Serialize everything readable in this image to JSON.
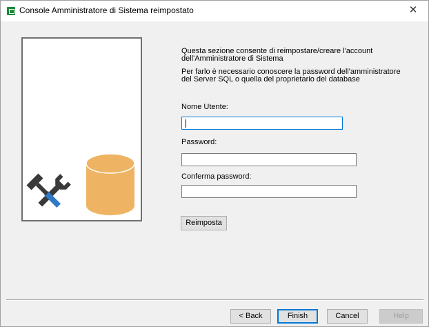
{
  "window": {
    "title": "Console Amministratore di Sistema reimpostato",
    "close_glyph": "✕"
  },
  "icons": {
    "app": "database-app-icon",
    "tools": "tools-icon",
    "database": "database-icon"
  },
  "colors": {
    "database": "#efb463",
    "tools": "#3a3a3a",
    "screwdriver": "#2f79c6",
    "focus": "#0078d7"
  },
  "intro": {
    "line1": "Questa sezione consente di reimpostare/creare l'account dell'Amministratore di Sistema",
    "line2": "Per farlo è necessario conoscere la password dell'amministratore del Server SQL o quella del proprietario del database"
  },
  "form": {
    "username_label": "Nome Utente:",
    "username_value": "",
    "password_label": "Password:",
    "password_value": "",
    "confirm_label": "Conferma password:",
    "confirm_value": "",
    "reset_button": "Reimposta"
  },
  "footer": {
    "back": "< Back",
    "finish": "Finish",
    "cancel": "Cancel",
    "help": "Help"
  }
}
